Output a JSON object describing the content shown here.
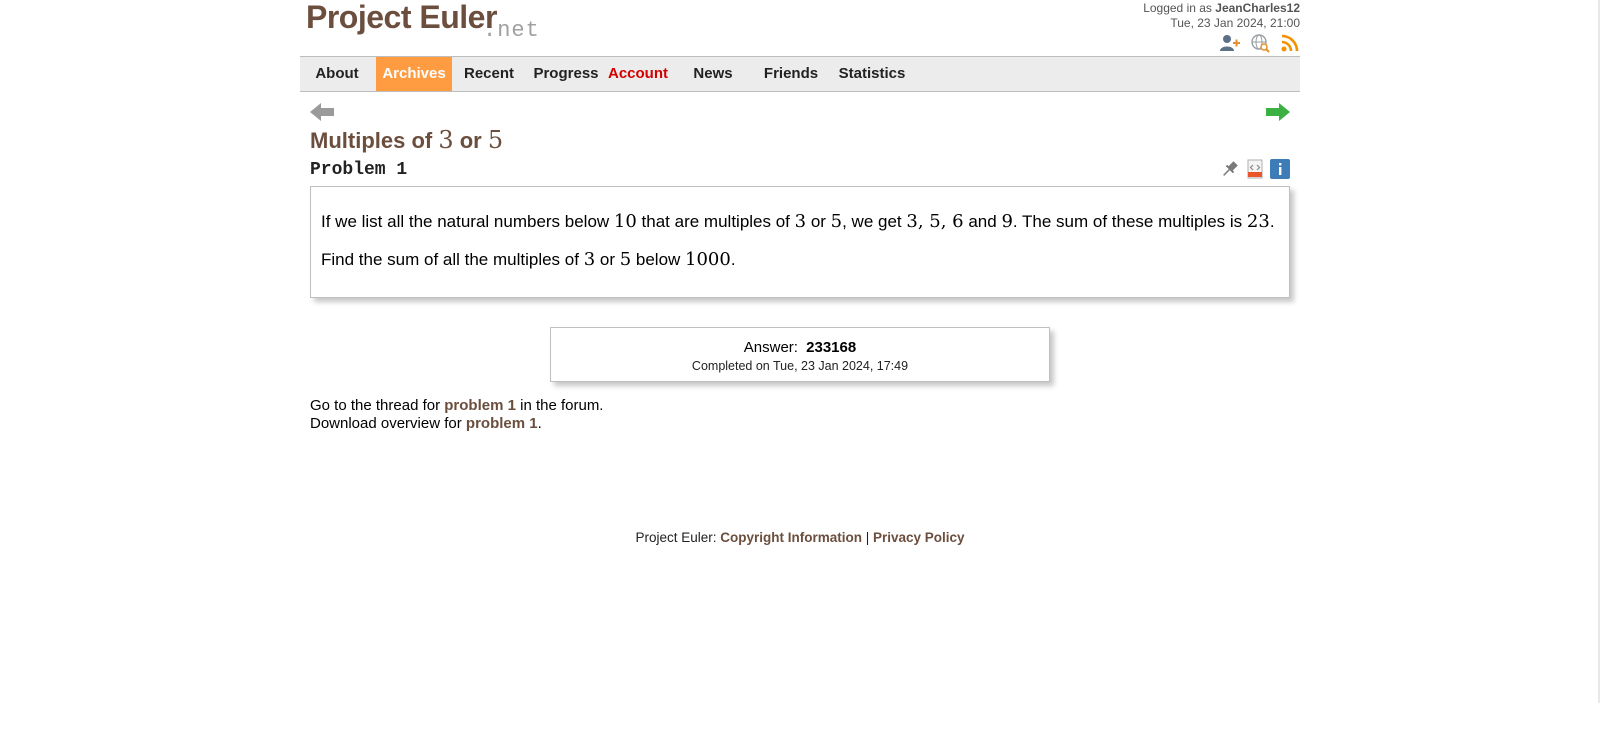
{
  "site": {
    "logo_main": "Project Euler",
    "logo_sub": ".net"
  },
  "user": {
    "logged_in_prefix": "Logged in as",
    "username": "JeanCharles12",
    "datetime": "Tue, 23 Jan 2024, 21:00"
  },
  "top_icons": [
    "add-friend-icon",
    "language-search-icon",
    "rss-feed-icon"
  ],
  "nav": {
    "items": [
      {
        "label": "About",
        "state": "normal"
      },
      {
        "label": "Archives",
        "state": "active"
      },
      {
        "label": "Recent",
        "state": "normal"
      },
      {
        "label": "Progress",
        "state": "normal"
      },
      {
        "label": "Account",
        "state": "alert"
      },
      {
        "label": "News",
        "state": "normal"
      },
      {
        "label": "Friends",
        "state": "normal"
      },
      {
        "label": "Statistics",
        "state": "normal"
      }
    ]
  },
  "problem": {
    "title_prefix": "Multiples of ",
    "title_a": "3",
    "title_or": " or ",
    "title_b": "5",
    "number_label": "Problem 1",
    "para1": {
      "t1": "If we list all the natural numbers below ",
      "m1": "10",
      "t2": " that are multiples of ",
      "m2": "3",
      "t3": " or ",
      "m3": "5",
      "t4": ", we get ",
      "m4": "3, 5, 6",
      "t5": " and ",
      "m5": "9",
      "t6": ". The sum of these multiples is ",
      "m6": "23",
      "t7": "."
    },
    "para2": {
      "t1": "Find the sum of all the multiples of ",
      "m1": "3",
      "t2": " or ",
      "m2": "5",
      "t3": " below ",
      "m3": "1000",
      "t4": "."
    }
  },
  "answer": {
    "label": "Answer:",
    "value": "233168",
    "completed": "Completed on Tue, 23 Jan 2024, 17:49"
  },
  "links": {
    "forum_pre": "Go to the thread for ",
    "forum_link": "problem 1",
    "forum_post": " in the forum.",
    "download_pre": "Download overview for ",
    "download_link": "problem 1",
    "download_post": "."
  },
  "footer": {
    "prefix": "Project Euler: ",
    "copyright": "Copyright Information",
    "sep": " | ",
    "privacy": "Privacy Policy"
  },
  "colors": {
    "brand": "#6b4e3d",
    "nav_active": "#ff9c42",
    "nav_alert": "#d40000",
    "next_arrow": "#3cb043",
    "prev_arrow": "#9a9a9a"
  }
}
